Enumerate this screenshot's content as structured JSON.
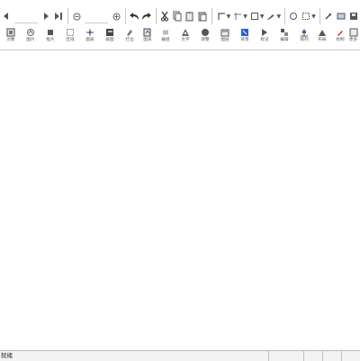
{
  "toolbar_primary": {
    "buttons": [
      {
        "name": "prev-icon"
      },
      {
        "name": "next-icon"
      },
      {
        "name": "last-icon"
      },
      {
        "name": "zoom-out-icon"
      },
      {
        "name": "zoom-in-icon"
      },
      {
        "name": "undo-icon"
      },
      {
        "name": "redo-icon"
      },
      {
        "name": "cut-icon"
      },
      {
        "name": "copy-icon"
      },
      {
        "name": "paste-icon"
      },
      {
        "name": "paste-special-icon"
      }
    ]
  },
  "toolbar_secondary": {
    "tools": [
      {
        "label": "对象",
        "icon": "object-icon"
      },
      {
        "label": "图片",
        "icon": "picture-icon"
      },
      {
        "label": "框片",
        "icon": "frame-icon"
      },
      {
        "label": "区域",
        "icon": "region-icon"
      },
      {
        "label": "图表",
        "icon": "chart-icon"
      },
      {
        "label": "裁图",
        "icon": "crop-icon"
      },
      {
        "label": "打边",
        "icon": "border-icon"
      },
      {
        "label": "图表",
        "icon": "graph-icon"
      },
      {
        "label": "编组",
        "icon": "group-icon"
      },
      {
        "label": "文字",
        "icon": "text-icon"
      },
      {
        "label": "调整",
        "icon": "adjust-icon"
      },
      {
        "label": "图层",
        "icon": "layer-icon"
      },
      {
        "label": "背景",
        "icon": "background-icon"
      },
      {
        "label": "标记",
        "icon": "marker-icon"
      },
      {
        "label": "编辑",
        "icon": "edit-icon"
      },
      {
        "label": "排列",
        "icon": "arrange-icon"
      },
      {
        "label": "布局",
        "icon": "layout-icon"
      },
      {
        "label": "绘制",
        "icon": "draw-icon"
      },
      {
        "label": "更多",
        "icon": "more-icon"
      }
    ]
  },
  "status": {
    "text": "就绪"
  },
  "colors": {
    "toolbar_bg": "#ffffff",
    "rule": "#c8c8c8",
    "statusbar_bg": "#f3f3f3",
    "icon_blue": "#2a62c9",
    "icon_dark": "#333333"
  }
}
